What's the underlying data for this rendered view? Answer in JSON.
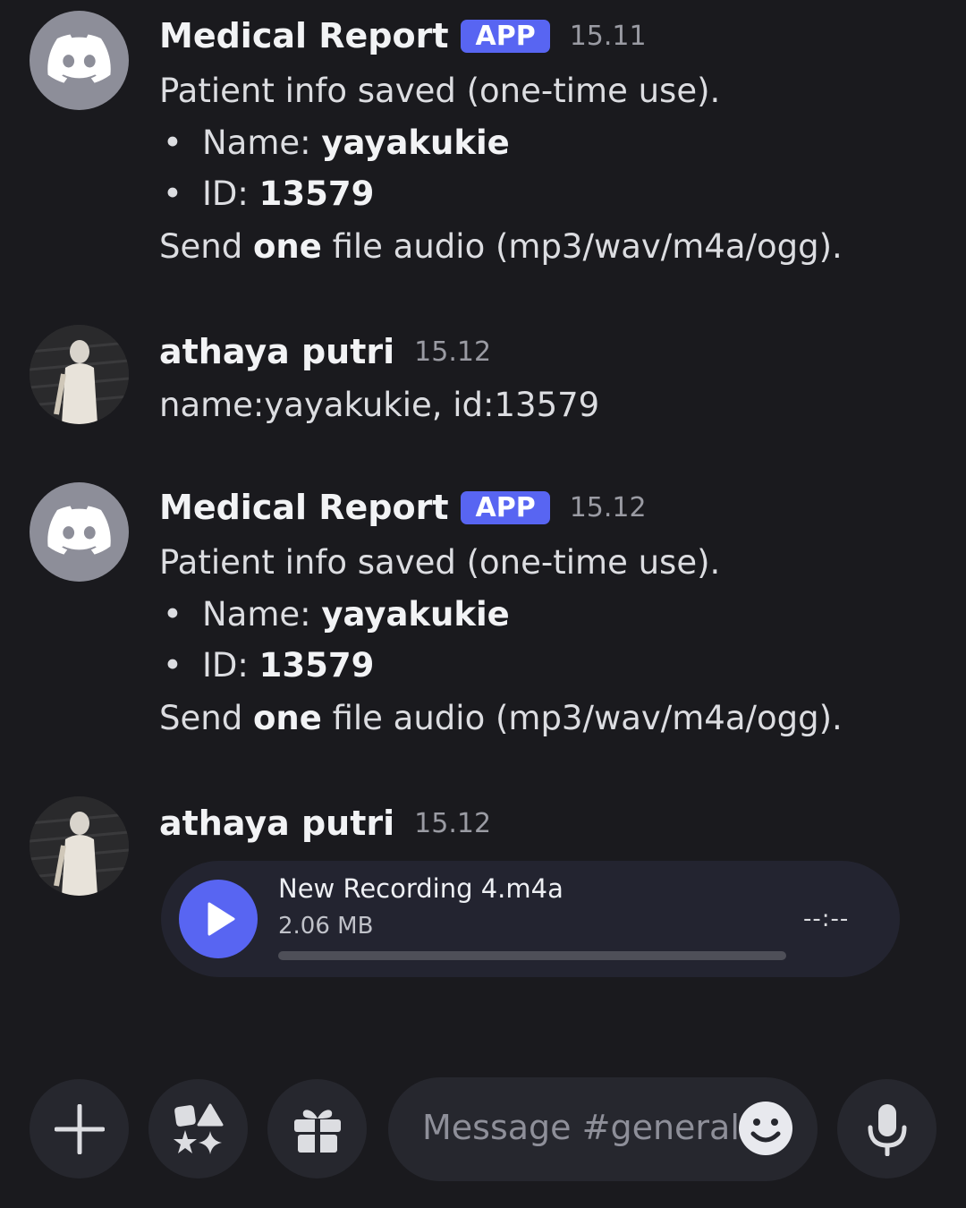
{
  "messages": [
    {
      "author": "Medical Report",
      "badge": "APP",
      "time": "15.11",
      "line1": "Patient info saved (one-time use).",
      "name_label": "Name: ",
      "name_value": "yayakukie",
      "id_label": "ID: ",
      "id_value": "13579",
      "send_pre": "Send ",
      "send_bold": "one",
      "send_post": " file audio (mp3/wav/m4a/ogg)."
    },
    {
      "author": "athaya putri",
      "time": "15.12",
      "text": "name:yayakukie, id:13579"
    },
    {
      "author": "Medical Report",
      "badge": "APP",
      "time": "15.12",
      "line1": "Patient info saved (one-time use).",
      "name_label": "Name: ",
      "name_value": "yayakukie",
      "id_label": "ID: ",
      "id_value": "13579",
      "send_pre": "Send ",
      "send_bold": "one",
      "send_post": " file audio (mp3/wav/m4a/ogg)."
    },
    {
      "author": "athaya putri",
      "time": "15.12",
      "attachment": {
        "filename": "New Recording 4.m4a",
        "size": "2.06 MB",
        "duration": "--:--",
        "progress": 0
      }
    }
  ],
  "composer": {
    "placeholder": "Message #general"
  },
  "icons": {
    "bot_avatar": "discord-logo-icon",
    "add": "plus-icon",
    "apps": "apps-sparkle-icon",
    "gift": "gift-icon",
    "emoji": "emoji-smile-icon",
    "mic": "microphone-icon",
    "play": "play-icon"
  },
  "colors": {
    "background": "#1a1a1e",
    "accent": "#5865f2",
    "timestamp": "#9a9ba3"
  }
}
